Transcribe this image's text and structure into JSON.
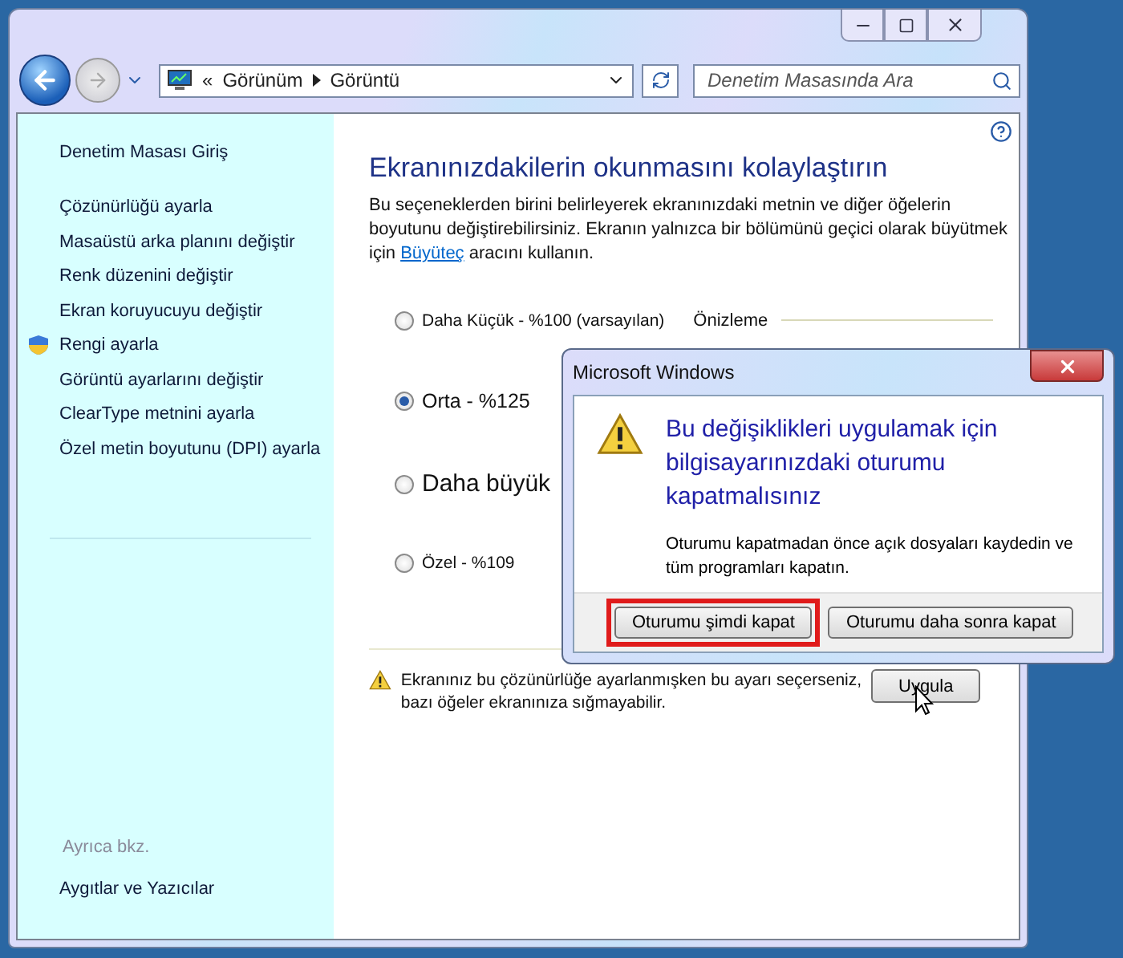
{
  "address_bar": {
    "overflow": "«",
    "breadcrumbs": [
      "Görünüm",
      "Görüntü"
    ]
  },
  "search": {
    "placeholder": "Denetim Masasında Ara"
  },
  "sidebar": {
    "home": "Denetim Masası Giriş",
    "items": [
      {
        "label": "Çözünürlüğü ayarla",
        "kind": "link"
      },
      {
        "label": "Masaüstü arka planını değiştir",
        "kind": "link"
      },
      {
        "label": "Renk düzenini değiştir",
        "kind": "link"
      },
      {
        "label": "Ekran koruyucuyu değiştir",
        "kind": "link"
      },
      {
        "label": "Rengi ayarla",
        "kind": "shield"
      },
      {
        "label": "Görüntü ayarlarını değiştir",
        "kind": "link"
      },
      {
        "label": "ClearType metnini ayarla",
        "kind": "link"
      },
      {
        "label": "Özel metin boyutunu (DPI) ayarla",
        "kind": "link"
      }
    ],
    "see_also": {
      "heading": "Ayrıca bkz.",
      "items": [
        "Aygıtlar ve Yazıcılar"
      ]
    }
  },
  "main": {
    "title": "Ekranınızdakilerin okunmasını kolaylaştırın",
    "description": {
      "before": "Bu seçeneklerden birini belirleyerek ekranınızdaki metnin ve diğer öğelerin boyutunu değiştirebilirsiniz. Ekranın yalnızca bir bölümünü geçici olarak büyütmek için ",
      "link": "Büyüteç",
      "after": " aracını kullanın."
    },
    "preview_label": "Önizleme",
    "options": [
      {
        "label": "Daha Küçük - %100 (varsayılan)",
        "kind": "small",
        "selected": false
      },
      {
        "label": "Orta - %125",
        "kind": "medium",
        "selected": true
      },
      {
        "label": "Daha büyük",
        "kind": "large",
        "selected": false
      },
      {
        "label": "Özel - %109",
        "kind": "small",
        "selected": false
      }
    ],
    "warning": "Ekranınız bu çözünürlüğe ayarlanmışken bu ayarı seçerseniz, bazı öğeler ekranınıza sığmayabilir.",
    "apply_button": "Uygula"
  },
  "dialog": {
    "title": "Microsoft Windows",
    "heading": "Bu değişiklikleri uygulamak için bilgisayarınızdaki oturumu kapatmalısınız",
    "body": "Oturumu kapatmadan önce açık dosyaları kaydedin ve tüm programları kapatın.",
    "buttons": [
      {
        "label": "Oturumu şimdi kapat",
        "highlighted": true
      },
      {
        "label": "Oturumu daha sonra kapat",
        "highlighted": false
      }
    ]
  }
}
